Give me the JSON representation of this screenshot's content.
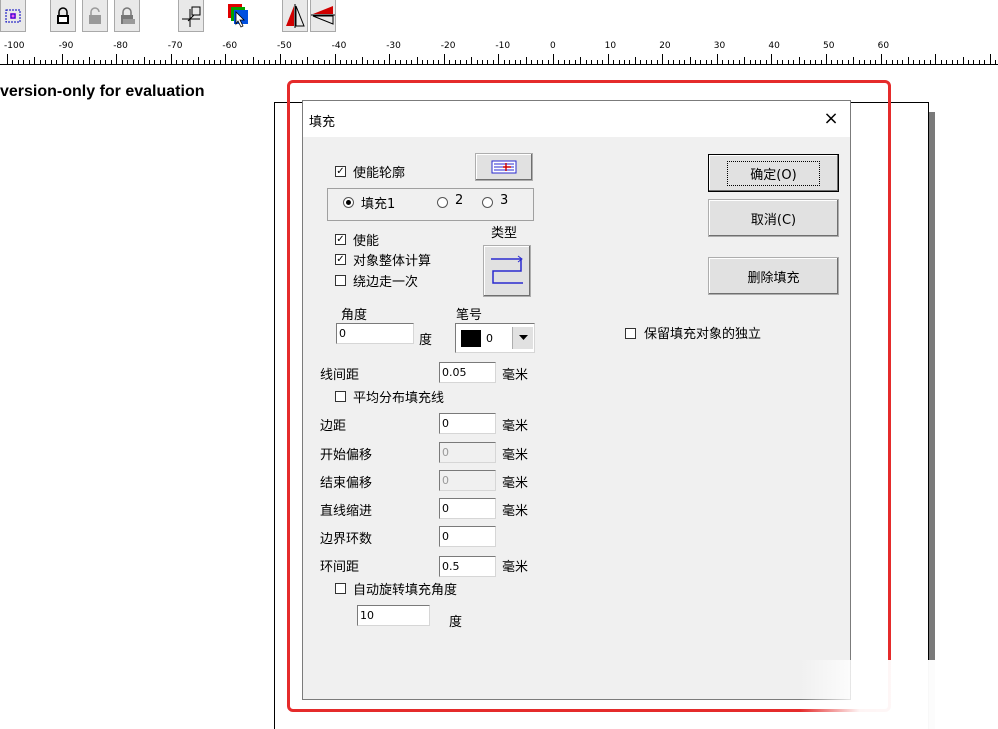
{
  "toolbar": {
    "icons": [
      "selection-box-icon",
      "lock-icon",
      "unlock-icon",
      "lock-all-icon",
      "align-origin-icon",
      "color-layer-icon",
      "mirror-horizontal-icon",
      "mirror-vertical-icon"
    ]
  },
  "ruler": {
    "labels": [
      "-100",
      "-90",
      "-80",
      "-70",
      "-60",
      "-50",
      "-40",
      "-30",
      "-20",
      "-10",
      "0",
      "10",
      "20",
      "30",
      "40",
      "50",
      "60"
    ]
  },
  "watermark": "version-only for evaluation",
  "dialog": {
    "title": "填充",
    "close": "×",
    "enable_outline": "使能轮廓",
    "fill1": "填充1",
    "fill2": "2",
    "fill3": "3",
    "enable": "使能",
    "whole_object": "对象整体计算",
    "edge_once": "绕边走一次",
    "type_label": "类型",
    "angle_label": "角度",
    "angle_value": "0",
    "angle_unit": "度",
    "pen_label": "笔号",
    "pen_value": "0",
    "line_spacing_label": "线间距",
    "line_spacing_value": "0.05",
    "line_spacing_unit": "毫米",
    "even_distribute": "平均分布填充线",
    "margin_label": "边距",
    "margin_value": "0",
    "margin_unit": "毫米",
    "start_offset_label": "开始偏移",
    "start_offset_value": "0",
    "start_offset_unit": "毫米",
    "end_offset_label": "结束偏移",
    "end_offset_value": "0",
    "end_offset_unit": "毫米",
    "line_indent_label": "直线缩进",
    "line_indent_value": "0",
    "line_indent_unit": "毫米",
    "border_loops_label": "边界环数",
    "border_loops_value": "0",
    "loop_spacing_label": "环间距",
    "loop_spacing_value": "0.5",
    "loop_spacing_unit": "毫米",
    "auto_rotate": "自动旋转填充角度",
    "rotate_value": "10",
    "rotate_unit": "度",
    "ok": "确定(O)",
    "cancel": "取消(C)",
    "delete_fill": "删除填充",
    "keep_independent": "保留填充对象的独立"
  },
  "state": {
    "enable_outline": true,
    "fill_selected": 1,
    "enable": true,
    "whole_object": true,
    "edge_once": false,
    "even_distribute": false,
    "auto_rotate": false,
    "keep_independent": false
  },
  "colors": {
    "highlight_border": "#e52b2b",
    "dialog_bg": "#f0f0f0",
    "pen_color": "#000000"
  }
}
